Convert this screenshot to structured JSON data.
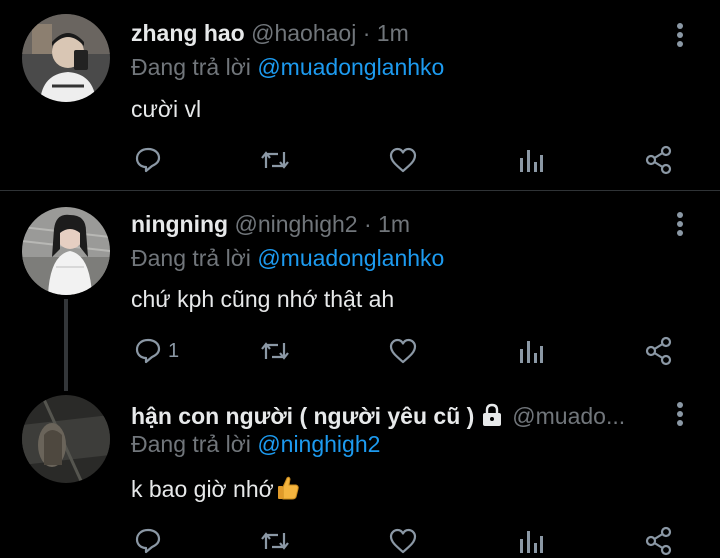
{
  "tweets": [
    {
      "name": "zhang hao",
      "handle": "@haohaoj",
      "sep": "·",
      "time": "1m",
      "reply_prefix": "Đang trả lời",
      "reply_to": "@muadonglanhko",
      "text": "cười vl",
      "reply_count": "",
      "avatar_color": "#3a3a3a"
    },
    {
      "name": "ningning",
      "handle": "@ninghigh2",
      "sep": "·",
      "time": "1m",
      "reply_prefix": "Đang trả lời",
      "reply_to": "@muadonglanhko",
      "text": "chứ kph cũng nhớ thật ah",
      "reply_count": "1",
      "avatar_color": "#8a8a8a"
    },
    {
      "name": "hận con người ( người yêu cũ )",
      "handle": "@muado...",
      "sep": "",
      "time": "",
      "reply_prefix": "Đang trả lời",
      "reply_to": "@ninghigh2",
      "text": "k bao giờ nhớ",
      "reply_count": "",
      "avatar_color": "#222"
    }
  ],
  "icons": [
    "reply-icon",
    "retweet-icon",
    "like-icon",
    "analytics-icon",
    "share-icon",
    "more-icon",
    "lock-icon",
    "thumbs-up-emoji"
  ],
  "colors": {
    "background": "#000000",
    "text": "#e7e9ea",
    "muted": "#71767b",
    "mention": "#1d9bf0",
    "divider": "#2f3336"
  }
}
